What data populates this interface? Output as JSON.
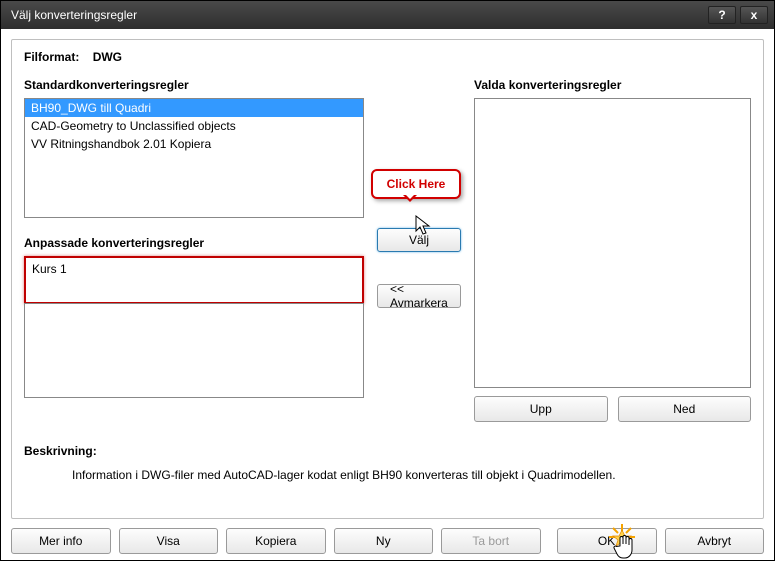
{
  "window": {
    "title": "Välj konverteringsregler",
    "help_icon": "?",
    "close_icon": "x"
  },
  "filformat": {
    "label": "Filformat:",
    "value": "DWG"
  },
  "standard": {
    "label": "Standardkonverteringsregler",
    "items": [
      "BH90_DWG till Quadri",
      "CAD-Geometry to Unclassified objects",
      "VV Ritningshandbok 2.01 Kopiera"
    ]
  },
  "custom": {
    "label": "Anpassade konverteringsregler",
    "items": [
      "Kurs 1"
    ]
  },
  "selected": {
    "label": "Valda konverteringsregler"
  },
  "buttons": {
    "select": "Välj",
    "deselect": "<< Avmarkera",
    "up": "Upp",
    "down": "Ned",
    "more_info": "Mer info",
    "show": "Visa",
    "copy": "Kopiera",
    "new": "Ny",
    "delete": "Ta bort",
    "ok": "OK",
    "cancel": "Avbryt"
  },
  "description": {
    "label": "Beskrivning:",
    "text": "Information i DWG-filer med AutoCAD-lager kodat enligt BH90 konverteras till objekt i Quadrimodellen."
  },
  "callout": {
    "text": "Click Here"
  }
}
